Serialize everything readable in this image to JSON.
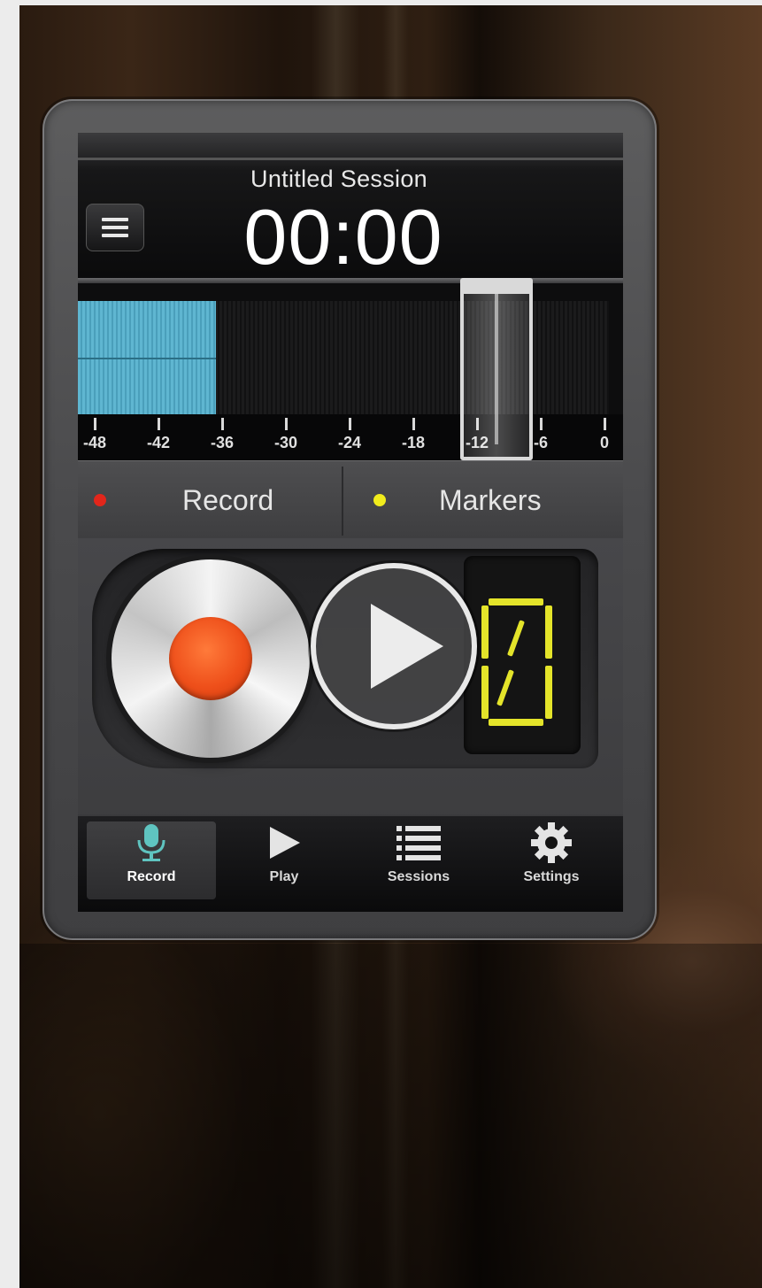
{
  "app": {
    "session_title": "Untitled Session",
    "timer": "00:00"
  },
  "meter": {
    "scale_labels": [
      "-48",
      "-42",
      "-36",
      "-30",
      "-24",
      "-18",
      "-12",
      "-6",
      "0"
    ],
    "input_level_db": -36,
    "peak_hold_db": -12,
    "level_color": "#5fb6d1"
  },
  "modes": {
    "record_label": "Record",
    "record_dot_color": "#e2261b",
    "markers_label": "Markers",
    "markers_dot_color": "#f1ec1c"
  },
  "controls": {
    "record_button_icon": "record-icon",
    "play_button_icon": "play-icon",
    "marker_count_display": "0",
    "display_color": "#e4e42a"
  },
  "tabbar": {
    "items": [
      {
        "label": "Record",
        "icon": "microphone-icon",
        "active": true
      },
      {
        "label": "Play",
        "icon": "play-icon",
        "active": false
      },
      {
        "label": "Sessions",
        "icon": "list-icon",
        "active": false
      },
      {
        "label": "Settings",
        "icon": "gear-icon",
        "active": false
      }
    ]
  },
  "colors": {
    "accent_teal": "#5fc4c0",
    "record_red": "#ee4f1a"
  }
}
